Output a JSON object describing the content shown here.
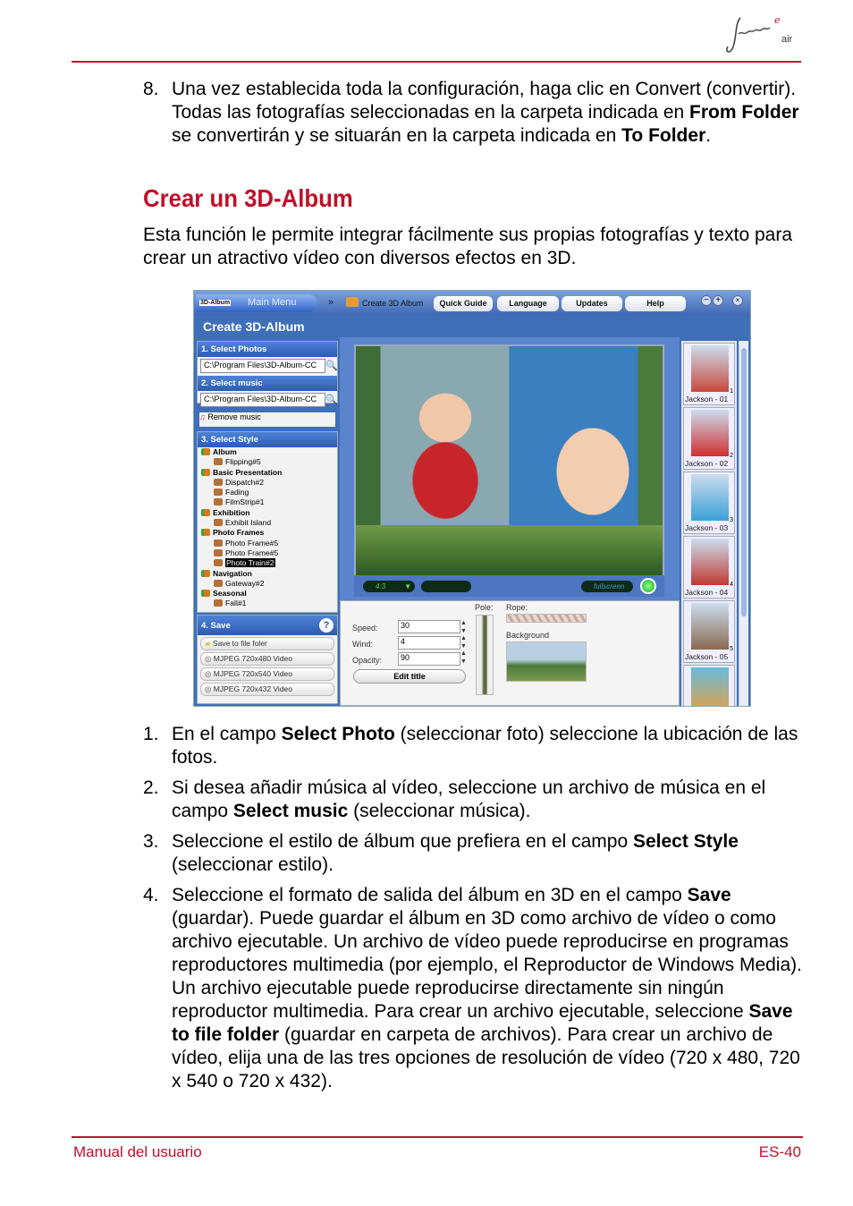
{
  "logo": {
    "text": "Journe air"
  },
  "step8": {
    "number": "8.",
    "t1": "Una vez establecida toda la configuración, haga clic en Convert (convertir). Todas las fotografías seleccionadas en la carpeta indicada en ",
    "b1": "From Folder",
    "t2": " se convertirán y se situarán en la carpeta indicada en ",
    "b2": "To Folder",
    "t3": "."
  },
  "heading": "Crear un 3D-Album",
  "intro": "Esta función le permite integrar fácilmente sus propias fotografías y texto para crear un atractivo vídeo con diversos efectos en 3D.",
  "app": {
    "logo": "3D-Album",
    "main_menu": "Main Menu",
    "breadcrumb": "Create 3D Album",
    "buttons": [
      "Quick Guide",
      "Language",
      "Updates",
      "Help"
    ],
    "title": "Create 3D-Album",
    "sections": {
      "photos": "1. Select Photos",
      "music": "2. Select music",
      "style": "3. Select Style",
      "save": "4. Save"
    },
    "photos_path": "C:\\Program Files\\3D-Album-CC",
    "music_path": "C:\\Program Files\\3D-Album-CC",
    "remove_music": "Remove music",
    "tree": [
      {
        "g": "Album"
      },
      {
        "c": "Flipping#5"
      },
      {
        "g": "Basic Presentation"
      },
      {
        "c": "Dispatch#2"
      },
      {
        "c": "Fading"
      },
      {
        "c": "FilmStrip#1"
      },
      {
        "g": "Exhibition"
      },
      {
        "c": "Exhibit Island"
      },
      {
        "g": "Photo Frames"
      },
      {
        "c": "Photo Frame#5"
      },
      {
        "c": "Photo Frame#5"
      },
      {
        "c": "Photo Train#2",
        "selected": true
      },
      {
        "g": "Navigation"
      },
      {
        "c": "Gateway#2"
      },
      {
        "g": "Seasonal"
      },
      {
        "c": "Fall#1"
      }
    ],
    "save_options": [
      "Save to file foler",
      "MJPEG 720x480 Video",
      "MJPEG 720x540 Video",
      "MJPEG 720x432 Video"
    ],
    "aspect": "4:3",
    "fullscreen": "fullscreen",
    "speed_label": "Speed:",
    "speed": "30",
    "wind_label": "Wind:",
    "wind": "4",
    "opacity_label": "Opacity:",
    "opacity": "90",
    "edit_title": "Edit title",
    "pole_label": "Pole:",
    "rope_label": "Rope:",
    "background_label": "Background",
    "thumbs": [
      {
        "label": "Jackson - 01",
        "n": "1"
      },
      {
        "label": "Jackson - 02",
        "n": "2"
      },
      {
        "label": "Jackson - 03",
        "n": "3"
      },
      {
        "label": "Jackson - 04",
        "n": "4"
      },
      {
        "label": "Jackson - 05",
        "n": "5"
      }
    ]
  },
  "steps": [
    {
      "n": "1.",
      "a": "En el campo ",
      "b": "Select Photo",
      "c": " (seleccionar foto) seleccione la ubicación de las fotos."
    },
    {
      "n": "2.",
      "a": "Si desea añadir música al vídeo, seleccione un archivo de música en el campo ",
      "b": "Select music",
      "c": " (seleccionar música)."
    },
    {
      "n": "3.",
      "a": "Seleccione el estilo de álbum que prefiera en el campo ",
      "b": "Select Style",
      "c": " (seleccionar estilo)."
    },
    {
      "n": "4.",
      "a": "Seleccione el formato de salida del álbum en 3D en el campo ",
      "b": "Save",
      "c": " (guardar). Puede guardar el álbum en 3D como archivo de vídeo o como archivo ejecutable. Un archivo de vídeo puede reproducirse en programas reproductores multimedia (por ejemplo, el Reproductor de Windows Media). Un archivo ejecutable puede reproducirse directamente sin ningún reproductor multimedia. Para crear un archivo ejecutable, seleccione ",
      "b2": "Save to file folder",
      "c2": " (guardar en carpeta de archivos). Para crear un archivo de vídeo, elija una de las tres opciones de resolución de vídeo (720 x 480, 720 x 540 o 720 x 432)."
    }
  ],
  "footer": {
    "left": "Manual del usuario",
    "right": "ES-40"
  }
}
